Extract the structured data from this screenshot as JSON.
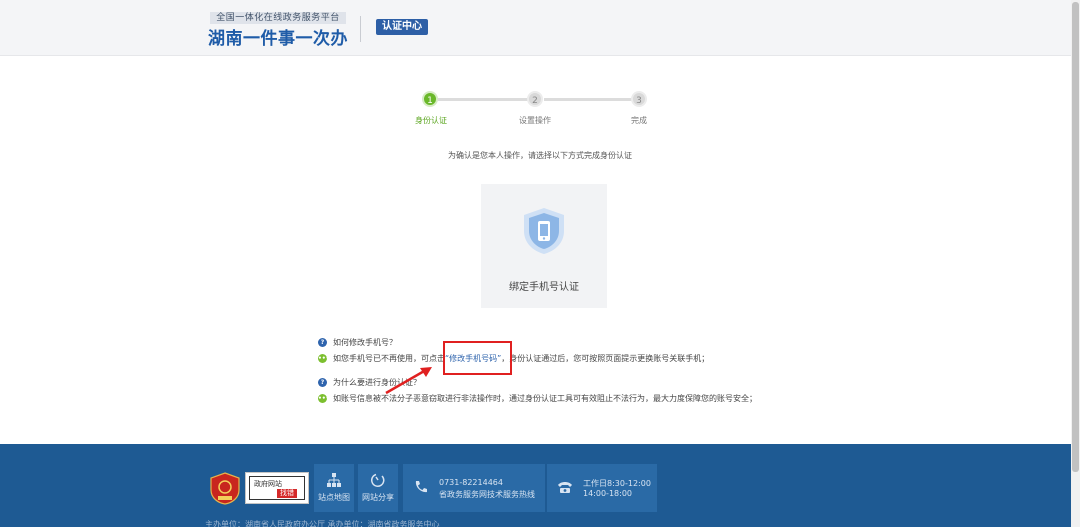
{
  "header": {
    "platform_label": "全国一体化在线政务服务平台",
    "site_name": "湖南一件事一次办",
    "section_badge": "认证中心"
  },
  "stepper": {
    "steps": [
      {
        "number": "1",
        "label": "身份认证",
        "active": true
      },
      {
        "number": "2",
        "label": "设置操作",
        "active": false
      },
      {
        "number": "3",
        "label": "完成",
        "active": false
      }
    ]
  },
  "instruction": "为确认是您本人操作，请选择以下方式完成身份认证",
  "auth_option": {
    "label": "绑定手机号认证",
    "icon": "shield-phone-icon"
  },
  "faq": {
    "q1": "如何修改手机号？",
    "a1_before": "如您手机号已不再使用，可点击",
    "a1_link": "“修改手机号码”",
    "a1_after": "，身份认证通过后，您可按照页面提示更换账号关联手机；",
    "q2": "为什么要进行身份认证？",
    "a2": "如账号信息被不法分子恶意窃取进行非法操作时，通过身份认证工具可有效阻止不法行为，最大力度保障您的账号安全；"
  },
  "footer": {
    "gov_site_label": "政府网站",
    "gov_site_tag": "找错",
    "sitemap_label": "站点地图",
    "share_label": "网站分享",
    "hotline_number": "0731-82214464",
    "hotline_desc": "省政务服务网技术服务热线",
    "hours_line1": "工作日8:30-12:00",
    "hours_line2": "14:00-18:00",
    "bottom_text": "主办单位：湖南省人民政府办公厅    承办单位：湖南省政务服务中心"
  },
  "colors": {
    "brand_blue": "#1f5ca8",
    "footer_blue": "#1e5a93",
    "step_active": "#6ab82a",
    "highlight_red": "#e02020"
  }
}
